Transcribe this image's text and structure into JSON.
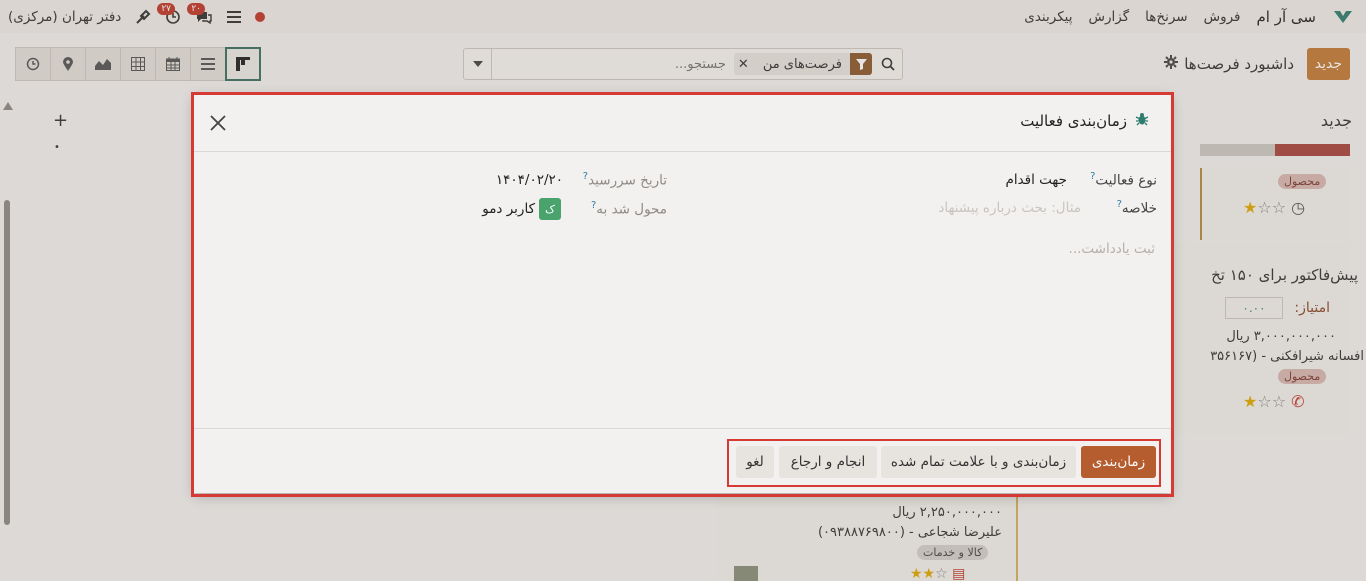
{
  "topbar": {
    "app_name": "سی آر ام",
    "menu": [
      "فروش",
      "سرنخ‌ها",
      "گزارش",
      "پیکربندی"
    ],
    "company": "دفتر تهران (مرکزی)",
    "messages_count": "۲۰",
    "activities_count": "۲۷"
  },
  "control": {
    "new_button": "جدید",
    "breadcrumb": "داشبورد فرصت‌ها",
    "search_facet": "فرصت‌های من",
    "search_placeholder": "جستجو..."
  },
  "background": {
    "column_title": "جدید",
    "column_progress": 0.5,
    "tag_product": "محصول",
    "card_title": "پیش‌فاکتور برای ۱۵۰ تخ",
    "score_label": "امتیاز:",
    "score_value": "۰.۰۰",
    "card_amount": "۳,۰۰۰,۰۰۰,۰۰۰ ریال",
    "card_contact": "افسانه شیرافکنی - (۳۵۶۱۶۷",
    "card2_amount": "۲,۲۵۰,۰۰۰,۰۰۰ ریال",
    "card2_contact": "علیرضا شجاعی - (۰۹۳۸۸۷۶۹۸۰۰)",
    "tag_goods": "کالا و خدمات"
  },
  "modal": {
    "title": "زمان‌بندی فعالیت",
    "activity_type_label": "نوع فعالیت",
    "activity_type_value": "جهت اقدام",
    "summary_label": "خلاصه",
    "summary_placeholder": "مثال: بحث درباره پیشنهاد",
    "due_date_label": "تاریخ سررسید",
    "due_date_value": "۱۴۰۴/۰۲/۲۰",
    "assigned_label": "محول شد به",
    "assigned_avatar": "ک",
    "assigned_value": "کاربر دمو",
    "note_placeholder": "ثبت یادداشت...",
    "help_mark": "?"
  },
  "footer": {
    "schedule": "زمان‌بندی",
    "schedule_mark_done": "زمان‌بندی و با علامت تمام شده",
    "done_and_return": "انجام و ارجاع",
    "cancel": "لغو"
  },
  "colors": {
    "primary": "#b65d30",
    "accent": "#c27a36",
    "highlight_frame": "#d63a34",
    "avatar": "#4aa36d"
  }
}
